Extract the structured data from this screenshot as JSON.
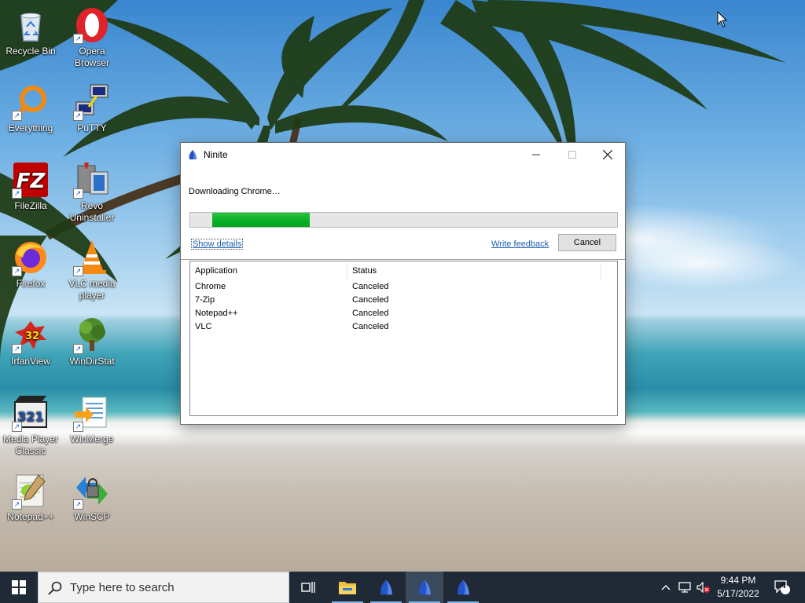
{
  "desktop_icons": [
    {
      "label": "Recycle Bin",
      "icon": "recycle-bin-icon"
    },
    {
      "label": "Opera Browser",
      "icon": "opera-icon"
    },
    {
      "label": "Everything",
      "icon": "everything-icon"
    },
    {
      "label": "PuTTY",
      "icon": "putty-icon"
    },
    {
      "label": "FileZilla",
      "icon": "filezilla-icon"
    },
    {
      "label": "Revo Uninstaller",
      "icon": "revo-uninstaller-icon"
    },
    {
      "label": "Firefox",
      "icon": "firefox-icon"
    },
    {
      "label": "VLC media player",
      "icon": "vlc-icon"
    },
    {
      "label": "IrfanView",
      "icon": "irfanview-icon"
    },
    {
      "label": "WinDirStat",
      "icon": "windirstat-icon"
    },
    {
      "label": "Media Player Classic",
      "icon": "media-player-classic-icon"
    },
    {
      "label": "WinMerge",
      "icon": "winmerge-icon"
    },
    {
      "label": "Notepad++",
      "icon": "notepadpp-icon"
    },
    {
      "label": "WinSCP",
      "icon": "winscp-icon"
    }
  ],
  "window": {
    "title": "Ninite",
    "status": "Downloading Chrome…",
    "progress": 0.28,
    "show_details": "Show details",
    "write_feedback": "Write feedback",
    "cancel": "Cancel",
    "columns": [
      "Application",
      "Status"
    ],
    "rows": [
      {
        "application": "Chrome",
        "status": "Canceled"
      },
      {
        "application": "7-Zip",
        "status": "Canceled"
      },
      {
        "application": "Notepad++",
        "status": "Canceled"
      },
      {
        "application": "VLC",
        "status": "Canceled"
      }
    ]
  },
  "taskbar": {
    "search_placeholder": "Type here to search",
    "time": "9:44 PM",
    "date": "5/17/2022",
    "notification_count": "4"
  },
  "colors": {
    "progress_fill": "#06b025",
    "taskbar_bg": "#1f2a36",
    "link": "#1a5fb4"
  }
}
